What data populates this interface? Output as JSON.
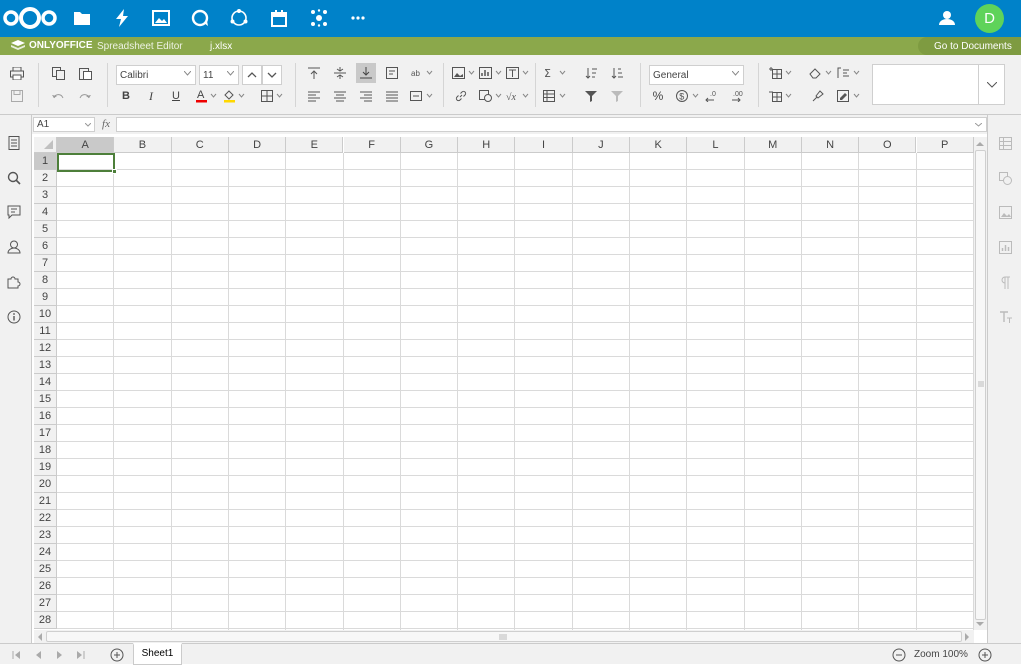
{
  "app": {
    "user_initial": "D"
  },
  "titlebar": {
    "brand": "ONLYOFFICE",
    "editor": "Spreadsheet Editor",
    "filename": "j.xlsx",
    "go_to_documents": "Go to Documents"
  },
  "toolbar": {
    "font_name": "Calibri",
    "font_size": "11",
    "number_format": "General",
    "percent": "%",
    "sigma": "Σ"
  },
  "formula_bar": {
    "cell_ref": "A1",
    "fx": "fx",
    "value": ""
  },
  "grid": {
    "columns": [
      "A",
      "B",
      "C",
      "D",
      "E",
      "F",
      "G",
      "H",
      "I",
      "J",
      "K",
      "L",
      "M",
      "N",
      "O",
      "P"
    ],
    "rows": [
      "1",
      "2",
      "3",
      "4",
      "5",
      "6",
      "7",
      "8",
      "9",
      "10",
      "11",
      "12",
      "13",
      "14",
      "15",
      "16",
      "17",
      "18",
      "19",
      "20",
      "21",
      "22",
      "23",
      "24",
      "25",
      "26",
      "27",
      "28"
    ],
    "selected_cell": "A1"
  },
  "status": {
    "sheet_tab": "Sheet1",
    "zoom_label": "Zoom 100%"
  },
  "colors": {
    "nextcloud_blue": "#0082c9",
    "title_green": "#8ba84b",
    "selection_green": "#4d7f3a",
    "avatar_green": "#5fd35a"
  }
}
